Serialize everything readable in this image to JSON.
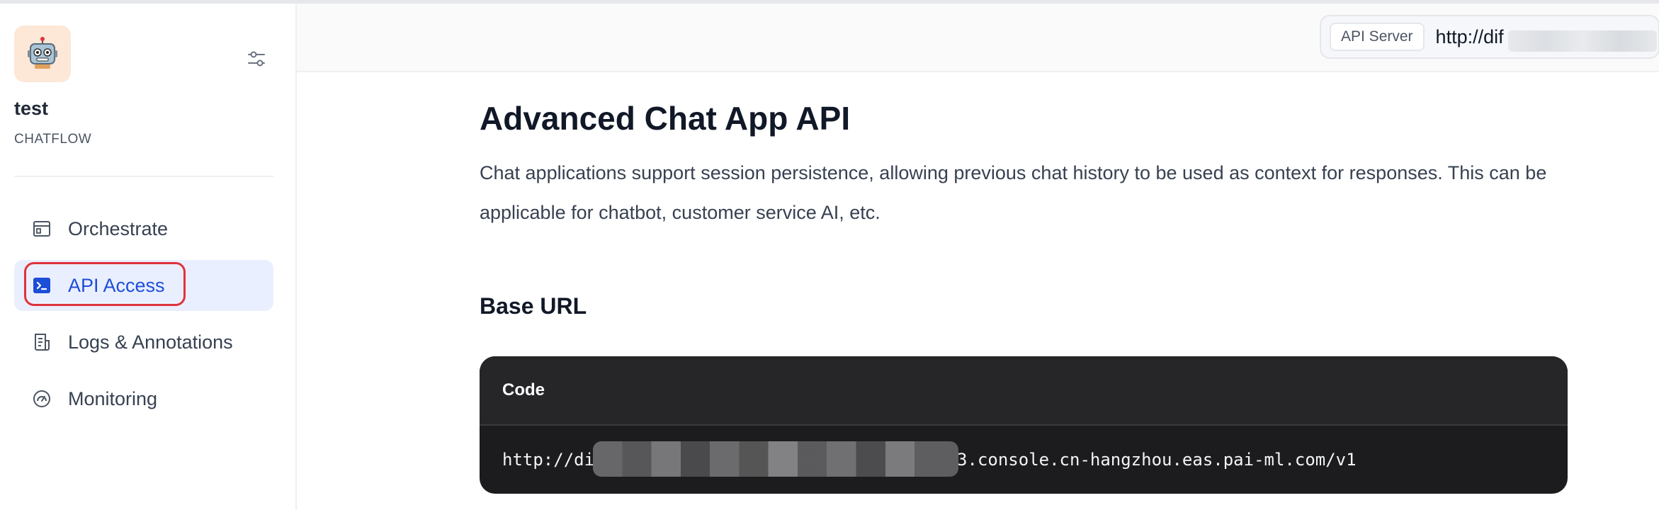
{
  "app": {
    "name": "test",
    "mode": "CHATFLOW",
    "icon": "robot-emoji"
  },
  "sidebar": {
    "items": [
      {
        "label": "Orchestrate",
        "icon": "orchestrate-icon",
        "active": false
      },
      {
        "label": "API Access",
        "icon": "terminal-icon",
        "active": true
      },
      {
        "label": "Logs & Annotations",
        "icon": "logs-icon",
        "active": false
      },
      {
        "label": "Monitoring",
        "icon": "gauge-icon",
        "active": false
      }
    ]
  },
  "topbar": {
    "api_server_label": "API Server",
    "api_server_url": "http://dif"
  },
  "main": {
    "title": "Advanced Chat App API",
    "description": "Chat applications support session persistence, allowing previous chat history to be used as context for responses. This can be applicable for chatbot, customer service AI, etc.",
    "base_url_heading": "Base URL",
    "code": {
      "label": "Code",
      "url_prefix": "http://di",
      "url_suffix": "3.console.cn-hangzhou.eas.pai-ml.com/v1"
    }
  },
  "colors": {
    "accent": "#1d4ed8",
    "active_bg": "#eaefff",
    "highlight_ring": "#e0323c",
    "code_bg": "#1c1c1e"
  }
}
